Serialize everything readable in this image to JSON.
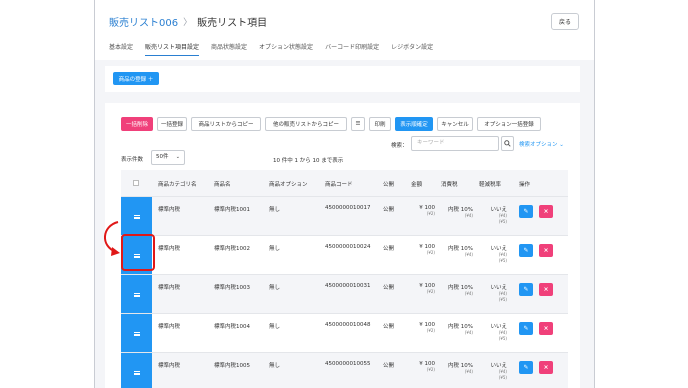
{
  "breadcrumb": {
    "parent": "販売リスト006",
    "separator": "〉",
    "current": "販売リスト項目"
  },
  "back_label": "戻る",
  "tabs": [
    "基本設定",
    "販売リスト項目設定",
    "商品状態設定",
    "オプション状態設定",
    "バーコード印刷設定",
    "レジボタン設定"
  ],
  "register_label": "商品の登録 ＋",
  "toolbar": {
    "bulk_delete": "一括削除",
    "bulk_register": "一括登録",
    "copy_from_list": "商品リストからコピー",
    "copy_from_other": "他の販売リストからコピー",
    "list_icon": "☰",
    "print": "印刷",
    "order_settings": "表示順確定",
    "cancel": "キャンセル",
    "option_bulk": "オプション一括登録"
  },
  "search": {
    "label": "検索：",
    "placeholder": "キーワード",
    "option_label": "検索オプション ⌄"
  },
  "display": {
    "label": "表示件数",
    "value": "50件"
  },
  "count_text": "10 件中 1 から 10 まで表示",
  "columns": [
    "商品カテゴリ名",
    "商品名",
    "商品オプション",
    "商品コード",
    "公開",
    "金額",
    "消費税",
    "軽減税率",
    "操作"
  ],
  "rows": [
    {
      "category": "標準内税",
      "name": "標準内税1001",
      "option": "無し",
      "code": "4500000010017",
      "public": "公開",
      "price": "¥ 100",
      "price_sub": "(¥2)",
      "tax": "内税 10%",
      "tax_sub": "(¥4)",
      "reduced": "いいえ",
      "reduced_sub1": "(¥4)",
      "reduced_sub2": "(¥5)"
    },
    {
      "category": "標準内税",
      "name": "標準内税1002",
      "option": "無し",
      "code": "4500000010024",
      "public": "公開",
      "price": "¥ 100",
      "price_sub": "(¥2)",
      "tax": "内税 10%",
      "tax_sub": "(¥4)",
      "reduced": "いいえ",
      "reduced_sub1": "(¥4)",
      "reduced_sub2": "(¥5)"
    },
    {
      "category": "標準内税",
      "name": "標準内税1003",
      "option": "無し",
      "code": "4500000010031",
      "public": "公開",
      "price": "¥ 100",
      "price_sub": "(¥2)",
      "tax": "内税 10%",
      "tax_sub": "(¥4)",
      "reduced": "いいえ",
      "reduced_sub1": "(¥4)",
      "reduced_sub2": "(¥5)"
    },
    {
      "category": "標準内税",
      "name": "標準内税1004",
      "option": "無し",
      "code": "4500000010048",
      "public": "公開",
      "price": "¥ 100",
      "price_sub": "(¥2)",
      "tax": "内税 10%",
      "tax_sub": "(¥4)",
      "reduced": "いいえ",
      "reduced_sub1": "(¥4)",
      "reduced_sub2": "(¥5)"
    },
    {
      "category": "標準内税",
      "name": "標準内税1005",
      "option": "無し",
      "code": "4500000010055",
      "public": "公開",
      "price": "¥ 100",
      "price_sub": "(¥2)",
      "tax": "内税 10%",
      "tax_sub": "(¥4)",
      "reduced": "いいえ",
      "reduced_sub1": "(¥4)",
      "reduced_sub2": "(¥5)"
    }
  ],
  "edit_icon": "✎",
  "delete_icon": "×",
  "colors": {
    "primary": "#2196f3",
    "danger": "#f0407a",
    "highlight": "#e01818"
  }
}
